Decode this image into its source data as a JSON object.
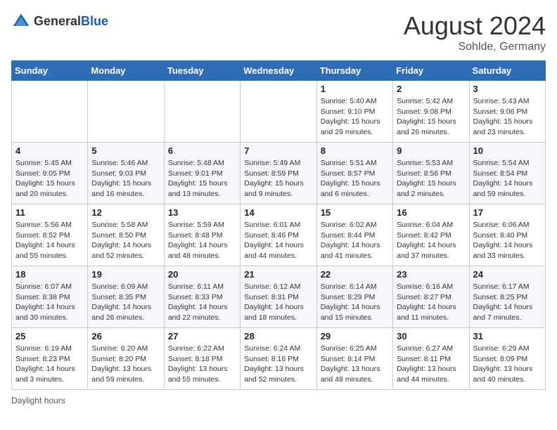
{
  "header": {
    "logo_general": "General",
    "logo_blue": "Blue",
    "month_title": "August 2024",
    "location": "Sohlde, Germany"
  },
  "calendar": {
    "days_of_week": [
      "Sunday",
      "Monday",
      "Tuesday",
      "Wednesday",
      "Thursday",
      "Friday",
      "Saturday"
    ],
    "weeks": [
      [
        {
          "day": "",
          "info": ""
        },
        {
          "day": "",
          "info": ""
        },
        {
          "day": "",
          "info": ""
        },
        {
          "day": "",
          "info": ""
        },
        {
          "day": "1",
          "info": "Sunrise: 5:40 AM\nSunset: 9:10 PM\nDaylight: 15 hours\nand 29 minutes."
        },
        {
          "day": "2",
          "info": "Sunrise: 5:42 AM\nSunset: 9:08 PM\nDaylight: 15 hours\nand 26 minutes."
        },
        {
          "day": "3",
          "info": "Sunrise: 5:43 AM\nSunset: 9:06 PM\nDaylight: 15 hours\nand 23 minutes."
        }
      ],
      [
        {
          "day": "4",
          "info": "Sunrise: 5:45 AM\nSunset: 9:05 PM\nDaylight: 15 hours\nand 20 minutes."
        },
        {
          "day": "5",
          "info": "Sunrise: 5:46 AM\nSunset: 9:03 PM\nDaylight: 15 hours\nand 16 minutes."
        },
        {
          "day": "6",
          "info": "Sunrise: 5:48 AM\nSunset: 9:01 PM\nDaylight: 15 hours\nand 13 minutes."
        },
        {
          "day": "7",
          "info": "Sunrise: 5:49 AM\nSunset: 8:59 PM\nDaylight: 15 hours\nand 9 minutes."
        },
        {
          "day": "8",
          "info": "Sunrise: 5:51 AM\nSunset: 8:57 PM\nDaylight: 15 hours\nand 6 minutes."
        },
        {
          "day": "9",
          "info": "Sunrise: 5:53 AM\nSunset: 8:56 PM\nDaylight: 15 hours\nand 2 minutes."
        },
        {
          "day": "10",
          "info": "Sunrise: 5:54 AM\nSunset: 8:54 PM\nDaylight: 14 hours\nand 59 minutes."
        }
      ],
      [
        {
          "day": "11",
          "info": "Sunrise: 5:56 AM\nSunset: 8:52 PM\nDaylight: 14 hours\nand 55 minutes."
        },
        {
          "day": "12",
          "info": "Sunrise: 5:58 AM\nSunset: 8:50 PM\nDaylight: 14 hours\nand 52 minutes."
        },
        {
          "day": "13",
          "info": "Sunrise: 5:59 AM\nSunset: 8:48 PM\nDaylight: 14 hours\nand 48 minutes."
        },
        {
          "day": "14",
          "info": "Sunrise: 6:01 AM\nSunset: 8:46 PM\nDaylight: 14 hours\nand 44 minutes."
        },
        {
          "day": "15",
          "info": "Sunrise: 6:02 AM\nSunset: 8:44 PM\nDaylight: 14 hours\nand 41 minutes."
        },
        {
          "day": "16",
          "info": "Sunrise: 6:04 AM\nSunset: 8:42 PM\nDaylight: 14 hours\nand 37 minutes."
        },
        {
          "day": "17",
          "info": "Sunrise: 6:06 AM\nSunset: 8:40 PM\nDaylight: 14 hours\nand 33 minutes."
        }
      ],
      [
        {
          "day": "18",
          "info": "Sunrise: 6:07 AM\nSunset: 8:38 PM\nDaylight: 14 hours\nand 30 minutes."
        },
        {
          "day": "19",
          "info": "Sunrise: 6:09 AM\nSunset: 8:35 PM\nDaylight: 14 hours\nand 26 minutes."
        },
        {
          "day": "20",
          "info": "Sunrise: 6:11 AM\nSunset: 8:33 PM\nDaylight: 14 hours\nand 22 minutes."
        },
        {
          "day": "21",
          "info": "Sunrise: 6:12 AM\nSunset: 8:31 PM\nDaylight: 14 hours\nand 18 minutes."
        },
        {
          "day": "22",
          "info": "Sunrise: 6:14 AM\nSunset: 8:29 PM\nDaylight: 14 hours\nand 15 minutes."
        },
        {
          "day": "23",
          "info": "Sunrise: 6:16 AM\nSunset: 8:27 PM\nDaylight: 14 hours\nand 11 minutes."
        },
        {
          "day": "24",
          "info": "Sunrise: 6:17 AM\nSunset: 8:25 PM\nDaylight: 14 hours\nand 7 minutes."
        }
      ],
      [
        {
          "day": "25",
          "info": "Sunrise: 6:19 AM\nSunset: 8:23 PM\nDaylight: 14 hours\nand 3 minutes."
        },
        {
          "day": "26",
          "info": "Sunrise: 6:20 AM\nSunset: 8:20 PM\nDaylight: 13 hours\nand 59 minutes."
        },
        {
          "day": "27",
          "info": "Sunrise: 6:22 AM\nSunset: 8:18 PM\nDaylight: 13 hours\nand 55 minutes."
        },
        {
          "day": "28",
          "info": "Sunrise: 6:24 AM\nSunset: 8:16 PM\nDaylight: 13 hours\nand 52 minutes."
        },
        {
          "day": "29",
          "info": "Sunrise: 6:25 AM\nSunset: 8:14 PM\nDaylight: 13 hours\nand 48 minutes."
        },
        {
          "day": "30",
          "info": "Sunrise: 6:27 AM\nSunset: 8:11 PM\nDaylight: 13 hours\nand 44 minutes."
        },
        {
          "day": "31",
          "info": "Sunrise: 6:29 AM\nSunset: 8:09 PM\nDaylight: 13 hours\nand 40 minutes."
        }
      ]
    ]
  },
  "footer": {
    "note": "Daylight hours"
  }
}
